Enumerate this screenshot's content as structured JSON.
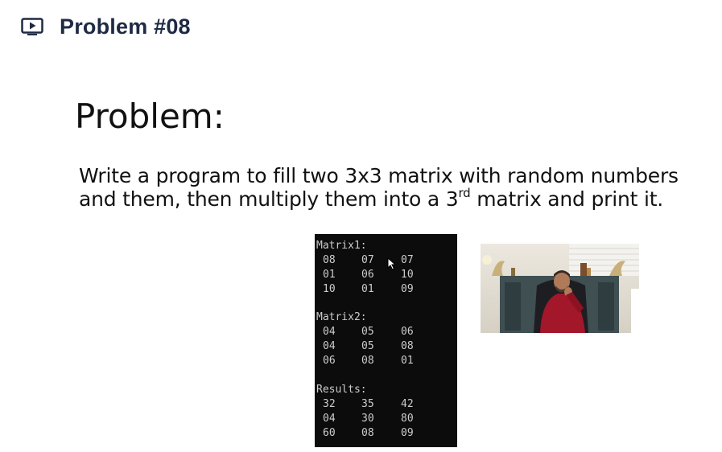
{
  "header": {
    "icon": "video-play-icon",
    "title": "Problem #08"
  },
  "slide": {
    "heading": "Problem:",
    "line1": "Write a program to fill two 3x3 matrix with random numbers",
    "line2_pre": "and them, then multiply them into a 3",
    "line2_sup": "rd",
    "line2_post": " matrix and print it."
  },
  "console": {
    "matrix1_label": "Matrix1:",
    "matrix1": [
      [
        "08",
        "07",
        "07"
      ],
      [
        "01",
        "06",
        "10"
      ],
      [
        "10",
        "01",
        "09"
      ]
    ],
    "matrix2_label": "Matrix2:",
    "matrix2": [
      [
        "04",
        "05",
        "06"
      ],
      [
        "04",
        "05",
        "08"
      ],
      [
        "06",
        "08",
        "01"
      ]
    ],
    "results_label": "Results:",
    "results": [
      [
        "32",
        "35",
        "42"
      ],
      [
        "04",
        "30",
        "80"
      ],
      [
        "60",
        "08",
        "09"
      ]
    ]
  },
  "colors": {
    "header_text": "#1f2a44",
    "console_bg": "#0c0c0c",
    "console_text": "#cccccc",
    "shirt": "#a3172a"
  }
}
